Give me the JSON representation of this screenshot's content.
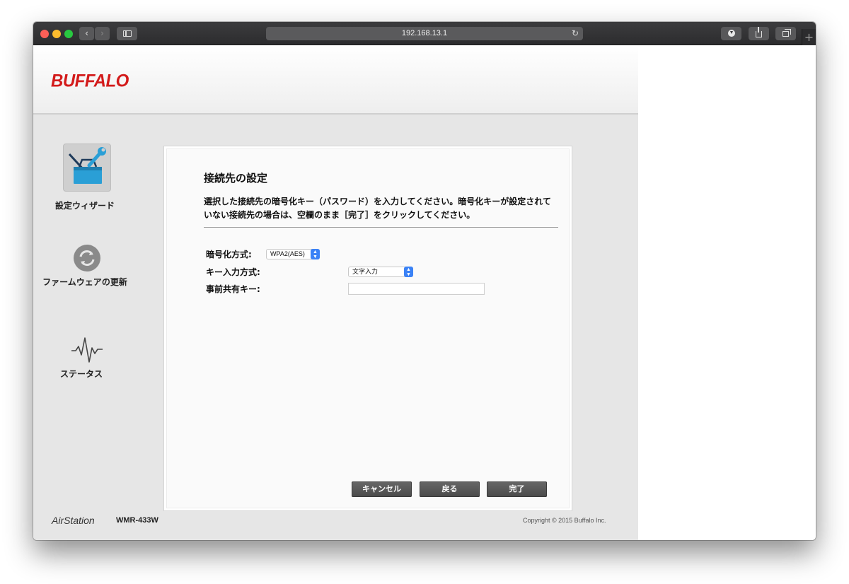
{
  "browser": {
    "url": "192.168.13.1",
    "nav_back": "‹",
    "nav_forward": "›",
    "new_tab": "+",
    "reload_icon": "↻",
    "icons": [
      "back-icon",
      "forward-icon",
      "sidebar-icon",
      "reload-icon",
      "download-icon",
      "share-icon",
      "tabs-icon",
      "plus-icon"
    ]
  },
  "header": {
    "logo": "BUFFALO",
    "logo_color": "#d31b1b"
  },
  "sidebar": {
    "items": [
      {
        "label": "設定ウィザード",
        "icon": "wizard-toolbox-icon",
        "active": true
      },
      {
        "label": "ファームウェアの更新",
        "icon": "refresh-update-icon",
        "active": false
      },
      {
        "label": "ステータス",
        "icon": "status-wave-icon",
        "active": false
      }
    ]
  },
  "panel": {
    "title": "接続先の設定",
    "description": "選択した接続先の暗号化キー（パスワード）を入力してください。暗号化キーが設定されていない接続先の場合は、空欄のまま［完了］をクリックしてください。",
    "fields": {
      "encryption_label": "暗号化方式:",
      "encryption_value": "WPA2(AES)",
      "key_mode_label": "キー入力方式:",
      "key_mode_value": "文字入力",
      "psk_label": "事前共有キー:",
      "psk_value": ""
    },
    "buttons": {
      "cancel": "キャンセル",
      "back": "戻る",
      "finish": "完了"
    }
  },
  "footer": {
    "brand": "AirStation",
    "model": "WMR-433W",
    "copyright": "Copyright © 2015 Buffalo Inc."
  },
  "colors": {
    "accent_blue": "#3b82f6",
    "button_gray": "#555555",
    "page_bg": "#e6e6e6"
  }
}
